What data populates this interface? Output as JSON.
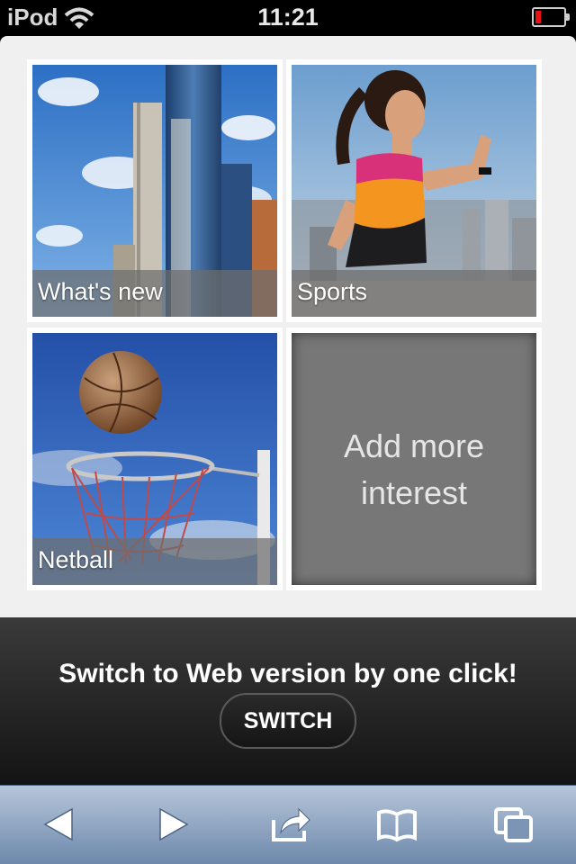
{
  "status_bar": {
    "device": "iPod",
    "time": "11:21"
  },
  "tiles": [
    {
      "label": "What's new",
      "image": "city-skyscrapers"
    },
    {
      "label": "Sports",
      "image": "woman-running"
    },
    {
      "label": "Netball",
      "image": "netball-hoop"
    },
    {
      "label": "Add more\ninterest"
    }
  ],
  "banner": {
    "text": "Switch to Web version by one click!",
    "button_label": "SWITCH"
  },
  "toolbar": {
    "icons": [
      "back-arrow-icon",
      "forward-arrow-icon",
      "share-icon",
      "bookmarks-icon",
      "pages-icon"
    ]
  },
  "colors": {
    "battery_low": "#e11111",
    "toolbar_top": "#b6c6da",
    "toolbar_bottom": "#6d88ab"
  }
}
